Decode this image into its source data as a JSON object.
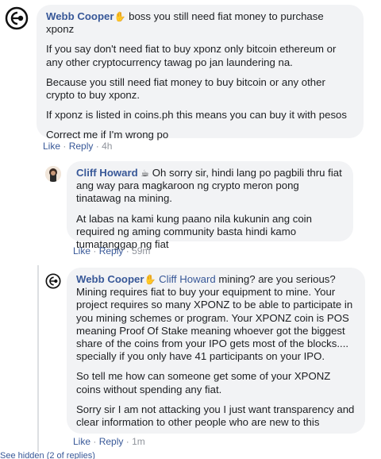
{
  "comments": [
    {
      "author": "Webb Cooper",
      "author_emoji": "✋",
      "mention": "",
      "first_line": "boss you still need fiat money to purchase xponz",
      "paragraphs": [
        "If you say don't need fiat to buy xponz only bitcoin ethereum or any other cryptocurrency tawag po jan laundering na.",
        "Because you still need fiat money to buy bitcoin or any other crypto to buy xponz.",
        "If xponz is listed in coins.ph this means you can buy it with pesos",
        "Correct me if I'm wrong po"
      ],
      "like_label": "Like",
      "reply_label": "Reply",
      "time": "4h"
    },
    {
      "author": "Cliff Howard",
      "author_emoji": "☕",
      "first_line": "Oh sorry sir, hindi lang po pagbili thru fiat ang way para magkaroon ng crypto meron pong tinatawag na mining.",
      "paragraphs": [
        "At labas na kami kung paano nila kukunin ang coin required ng aming community basta hindi kamo tumatanggap ng fiat"
      ],
      "like_label": "Like",
      "reply_label": "Reply",
      "time": "59m"
    },
    {
      "author": "Webb Cooper",
      "author_emoji": "✋",
      "mention": "Cliff Howard",
      "first_line": "mining? are you serious? Mining requires fiat to buy your equipment to mine. Your project requires so many XPONZ to be able to participate in you mining schemes or program. Your XPONZ coin is POS meaning Proof Of Stake meaning whoever got the biggest share of the coins from your IPO gets most of the blocks.... specially if you only have 41 participants on your IPO.",
      "paragraphs": [
        "So tell me how can someone get some of your XPONZ coins without spending any fiat.",
        "Sorry sir I am not attacking you I just want transparency and clear information to other people who are new to this"
      ],
      "like_label": "Like",
      "reply_label": "Reply",
      "time": "1m"
    }
  ],
  "separator": "·",
  "more_replies_label": "See hidden (2 of replies)"
}
